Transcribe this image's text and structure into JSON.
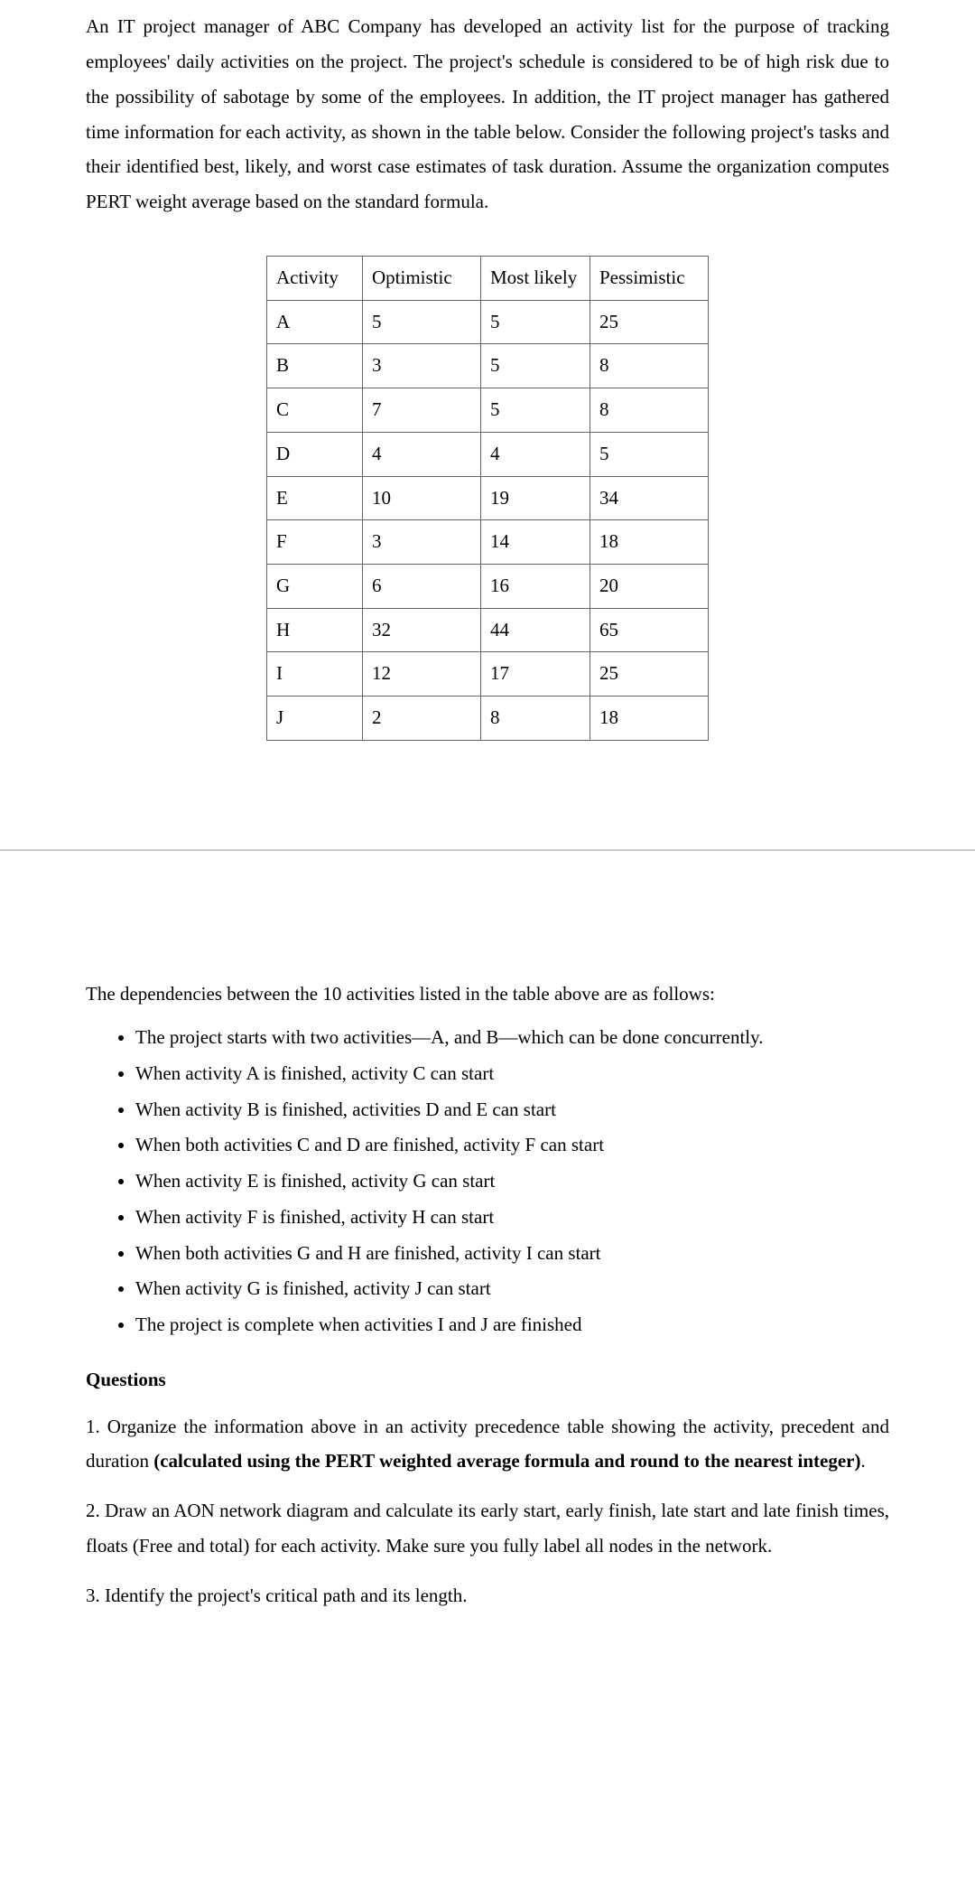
{
  "intro_paragraph": "An IT project manager of ABC Company has developed an activity list for the purpose of tracking employees' daily activities on the project. The project's schedule is considered to be of high risk due to the possibility of sabotage by some of the employees. In addition, the IT project manager has gathered time information for each activity, as shown in the table below.  Consider the following project's tasks and their identified best, likely, and worst case estimates of task duration. Assume the organization computes PERT weight average based on the standard formula.",
  "chart_data": {
    "type": "table",
    "headers": [
      "Activity",
      "Optimistic",
      "Most likely",
      "Pessimistic"
    ],
    "rows": [
      {
        "activity": "A",
        "optimistic": "5",
        "most_likely": "5",
        "pessimistic": "25"
      },
      {
        "activity": "B",
        "optimistic": "3",
        "most_likely": "5",
        "pessimistic": "8"
      },
      {
        "activity": "C",
        "optimistic": "7",
        "most_likely": "5",
        "pessimistic": "8"
      },
      {
        "activity": "D",
        "optimistic": "4",
        "most_likely": "4",
        "pessimistic": "5"
      },
      {
        "activity": "E",
        "optimistic": "10",
        "most_likely": "19",
        "pessimistic": "34"
      },
      {
        "activity": "F",
        "optimistic": "3",
        "most_likely": "14",
        "pessimistic": "18"
      },
      {
        "activity": "G",
        "optimistic": "6",
        "most_likely": "16",
        "pessimistic": "20"
      },
      {
        "activity": "H",
        "optimistic": "32",
        "most_likely": "44",
        "pessimistic": "65"
      },
      {
        "activity": "I",
        "optimistic": "12",
        "most_likely": "17",
        "pessimistic": "25"
      },
      {
        "activity": "J",
        "optimistic": "2",
        "most_likely": "8",
        "pessimistic": "18"
      }
    ]
  },
  "dependencies_intro": "The dependencies between the 10 activities listed in the table above are as follows:",
  "dependencies": [
    "The project starts with two activities—A, and B—which can be done concurrently.",
    "When activity A is finished, activity C can start",
    "When activity B is finished, activities D and E can start",
    "When both activities C and D are finished, activity F can start",
    "When activity E is finished, activity G can start",
    "When activity F is finished, activity H can start",
    "When both activities G and H are finished, activity I can start",
    "When activity G is finished, activity J can start",
    "The project is complete when activities I and J are finished"
  ],
  "questions_heading": "Questions",
  "q1_prefix": "1. Organize the information above in an activity precedence table showing the activity, precedent and duration ",
  "q1_bold": "(calculated using the PERT weighted average formula and round to the nearest integer)",
  "q1_suffix": ".",
  "q2": "2. Draw an AON network diagram and calculate its early start, early finish, late start and late finish times, floats (Free and total) for each activity.  Make sure you fully label all nodes in the network.",
  "q3": "3. Identify the project's critical path and its length."
}
